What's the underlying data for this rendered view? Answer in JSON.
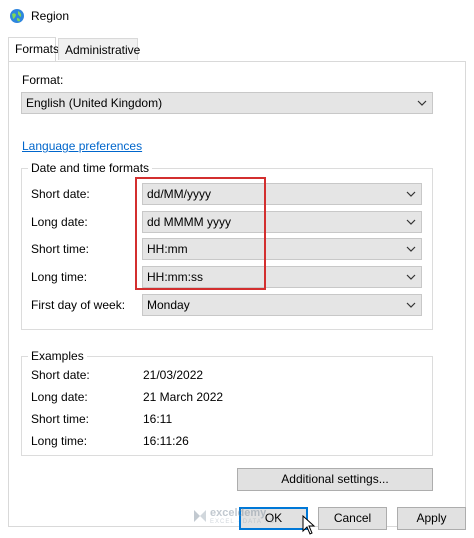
{
  "window": {
    "title": "Region"
  },
  "tabs": [
    {
      "label": "Formats"
    },
    {
      "label": "Administrative"
    }
  ],
  "format": {
    "label": "Format:",
    "value": "English (United Kingdom)"
  },
  "language_link": "Language preferences",
  "datetime": {
    "group_title": "Date and time formats",
    "rows": [
      {
        "label": "Short date:",
        "value": "dd/MM/yyyy"
      },
      {
        "label": "Long date:",
        "value": "dd MMMM yyyy"
      },
      {
        "label": "Short time:",
        "value": "HH:mm"
      },
      {
        "label": "Long time:",
        "value": "HH:mm:ss"
      },
      {
        "label": "First day of week:",
        "value": "Monday"
      }
    ]
  },
  "examples": {
    "group_title": "Examples",
    "rows": [
      {
        "label": "Short date:",
        "value": "21/03/2022"
      },
      {
        "label": "Long date:",
        "value": "21 March 2022"
      },
      {
        "label": "Short time:",
        "value": "16:11"
      },
      {
        "label": "Long time:",
        "value": "16:11:26"
      }
    ]
  },
  "buttons": {
    "additional": "Additional settings...",
    "ok": "OK",
    "cancel": "Cancel",
    "apply": "Apply"
  },
  "watermark": {
    "name": "exceldemy",
    "sub": "EXCEL · DATA · BI"
  },
  "colors": {
    "highlight": "#d32f2f",
    "link": "#0066cc",
    "combo_bg": "#e5e5e5"
  },
  "icons": {
    "app": "globe-icon",
    "dropdown": "chevron-down-icon",
    "cursor": "mouse-cursor-icon"
  }
}
